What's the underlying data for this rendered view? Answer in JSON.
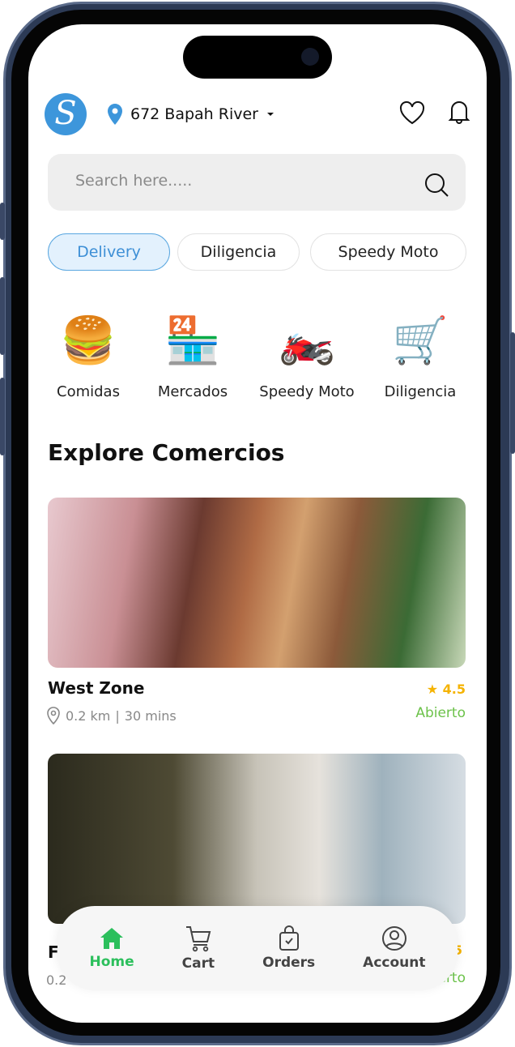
{
  "header": {
    "logo_letter": "S",
    "location": "672 Bapah River"
  },
  "search": {
    "placeholder": "Search here....."
  },
  "chips": [
    {
      "label": "Delivery",
      "active": true
    },
    {
      "label": "Diligencia"
    },
    {
      "label": "Speedy Moto"
    }
  ],
  "categories": [
    {
      "label": "Comidas",
      "icon": "burger-icon"
    },
    {
      "label": "Mercados",
      "icon": "market-icon"
    },
    {
      "label": "Speedy Moto",
      "icon": "motorcycle-icon"
    },
    {
      "label": "Diligencia",
      "icon": "stagecoach-icon"
    }
  ],
  "section_title": "Explore Comercios",
  "stores": [
    {
      "name": "West Zone",
      "distance": "0.2 km",
      "time": "30 mins",
      "rating": "4.5",
      "status": "Abierto"
    },
    {
      "name": "F",
      "distance": "0.2",
      "rating": "5",
      "status": "erto"
    }
  ],
  "nav": [
    {
      "label": "Home",
      "active": true
    },
    {
      "label": "Cart"
    },
    {
      "label": "Orders"
    },
    {
      "label": "Account"
    }
  ],
  "colors": {
    "accent": "#3d96db",
    "active_nav": "#2cbf5c",
    "rating": "#f5b301",
    "open": "#6cc24a"
  }
}
